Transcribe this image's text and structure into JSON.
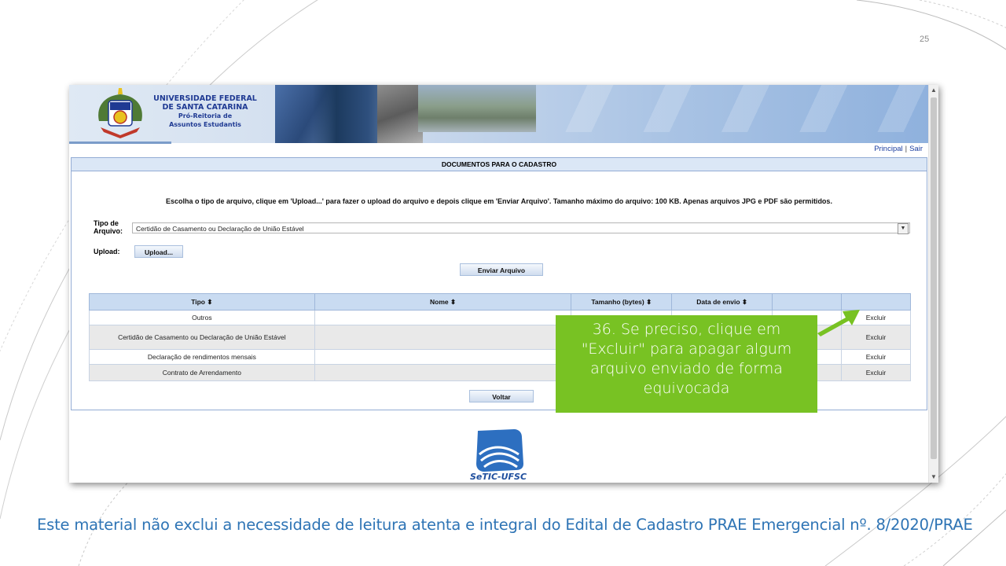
{
  "slide": {
    "page_number": "25",
    "footer_note": "Este material não exclui a necessidade de leitura atenta e integral do Edital de Cadastro PRAE Emergencial nº. 8/2020/PRAE"
  },
  "header": {
    "university_line1": "UNIVERSIDADE FEDERAL",
    "university_line2": "DE SANTA CATARINA",
    "university_line3": "Pró-Reitoria de",
    "university_line4": "Assuntos Estudantis"
  },
  "top_links": {
    "principal": "Principal",
    "separator": "|",
    "sair": "Sair"
  },
  "panel": {
    "title": "DOCUMENTOS PARA O CADASTRO",
    "instructions": "Escolha o tipo de arquivo, clique em 'Upload...' para fazer o upload do arquivo e depois clique em 'Enviar Arquivo'. Tamanho máximo do arquivo: 100 KB. Apenas arquivos JPG e PDF são permitidos.",
    "tipo_label_1": "Tipo de",
    "tipo_label_2": "Arquivo:",
    "tipo_selected": "Certidão de Casamento ou Declaração de União Estável",
    "upload_label": "Upload:",
    "upload_button": "Upload...",
    "enviar_button": "Enviar Arquivo",
    "voltar_button": "Voltar"
  },
  "table": {
    "headers": [
      "Tipo ⬍",
      "Nome ⬍",
      "Tamanho (bytes) ⬍",
      "Data de envio ⬍",
      "",
      ""
    ],
    "rows": [
      {
        "tipo": "Outros",
        "download": "d",
        "excluir": "Excluir"
      },
      {
        "tipo": "Certidão de Casamento ou Declaração de União Estável",
        "download": "d",
        "excluir": "Excluir"
      },
      {
        "tipo": "Declaração de rendimentos mensais",
        "download": "d",
        "excluir": "Excluir"
      },
      {
        "tipo": "Contrato de Arrendamento",
        "download": "d",
        "excluir": "Excluir"
      }
    ]
  },
  "footer_logo": {
    "text": "SeTIC-UFSC"
  },
  "callout": {
    "line1": "36. Se preciso, clique em",
    "line2": "\"Excluir\" para apagar algum",
    "line3": "arquivo enviado de forma",
    "line4": "equivocada"
  },
  "colors": {
    "callout_green": "#78c223",
    "footer_text_blue": "#2e74b5",
    "link_blue": "#1d3fa0"
  }
}
